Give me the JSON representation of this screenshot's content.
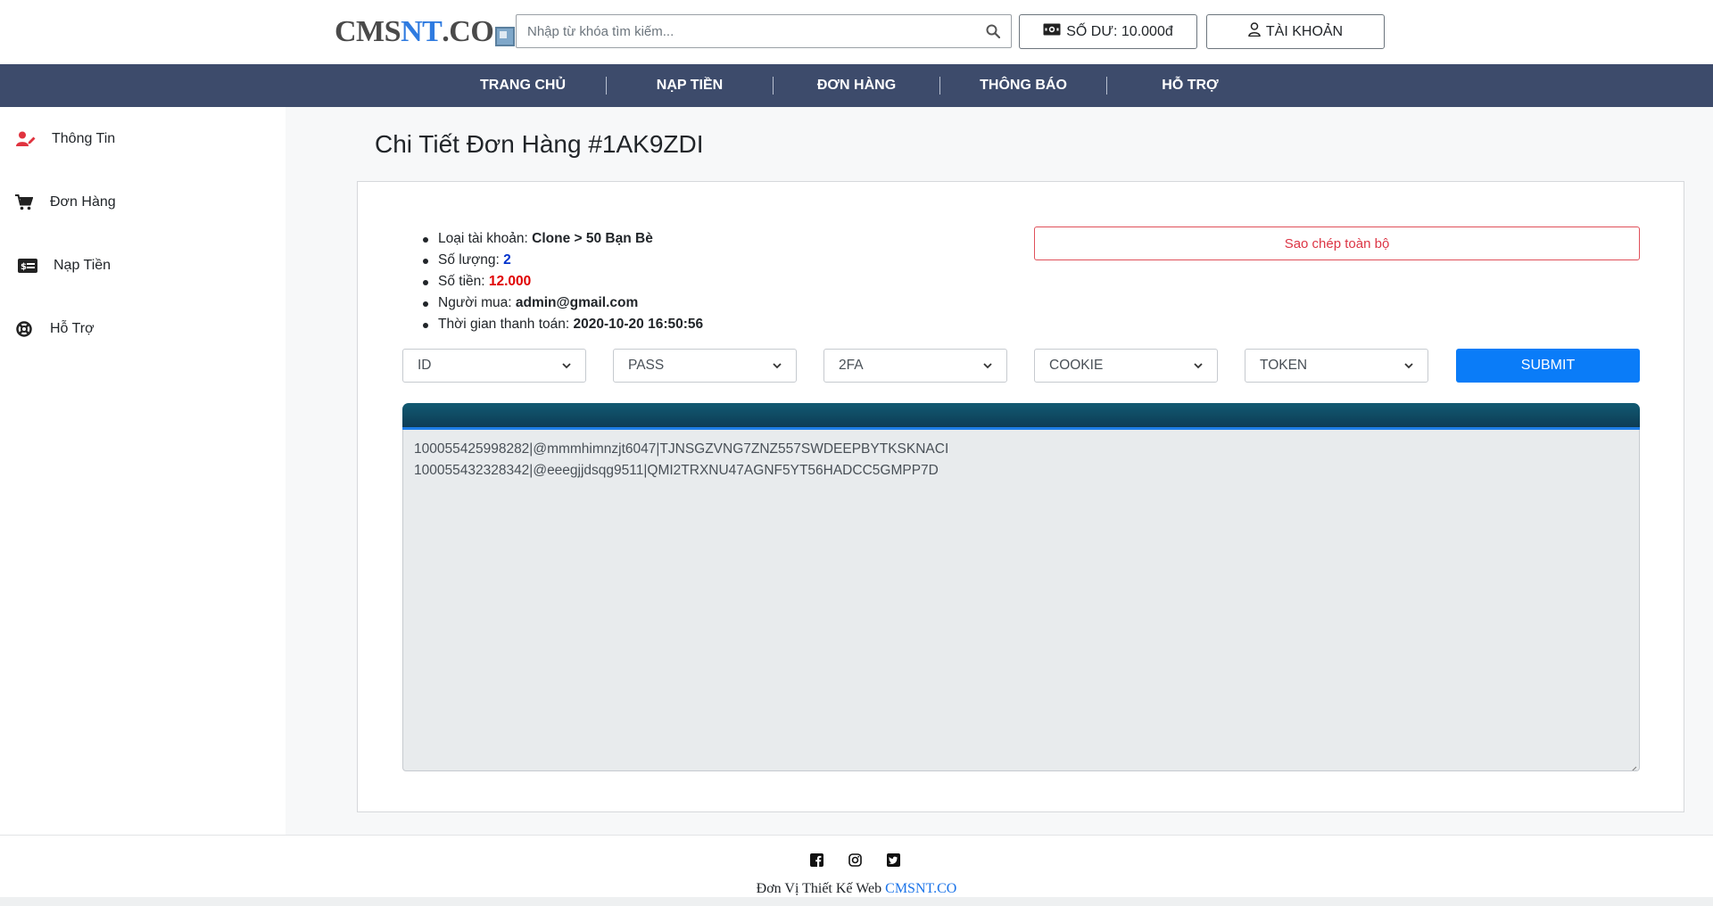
{
  "header": {
    "logo": {
      "part1": "CMS",
      "part2": "NT",
      "part3": ".CO"
    },
    "search": {
      "placeholder": "Nhập từ khóa tìm kiếm...",
      "value": ""
    },
    "balance_label": "SỐ DƯ: 10.000đ",
    "account_label": "TÀI KHOẢN"
  },
  "nav": {
    "items": [
      {
        "label": "TRANG CHỦ"
      },
      {
        "label": "NẠP TIỀN"
      },
      {
        "label": "ĐƠN HÀNG"
      },
      {
        "label": "THÔNG BÁO"
      },
      {
        "label": "HỖ TRỢ"
      }
    ]
  },
  "sidebar": {
    "items": [
      {
        "label": "Thông Tin",
        "icon": "user-edit-icon"
      },
      {
        "label": "Đơn Hàng",
        "icon": "cart-icon"
      },
      {
        "label": "Nạp Tiền",
        "icon": "money-card-icon"
      },
      {
        "label": "Hỗ Trợ",
        "icon": "lifebuoy-icon"
      }
    ]
  },
  "order": {
    "title": "Chi Tiết Đơn Hàng #1AK9ZDI",
    "info": [
      {
        "label": "Loại tài khoản: ",
        "value": "Clone > 50 Bạn Bè"
      },
      {
        "label": "Số lượng: ",
        "value": "2"
      },
      {
        "label": "Số tiền: ",
        "value": "12.000"
      },
      {
        "label": "Người mua: ",
        "value": "admin@gmail.com"
      },
      {
        "label": "Thời gian thanh toán: ",
        "value": "2020-10-20 16:50:56"
      }
    ],
    "copy_button": "Sao chép toàn bộ",
    "selects": [
      "ID",
      "PASS",
      "2FA",
      "COOKIE",
      "TOKEN"
    ],
    "submit_button": "SUBMIT",
    "output_lines": [
      "100055425998282|@mmmhimnzjt6047|TJNSGZVNG7ZNZ557SWDEEPBYTKSKNACI",
      "100055432328342|@eeegjjdsqg9511|QMI2TRXNU47AGNF5YT56HADCC5GMPP7D"
    ]
  },
  "footer": {
    "text": "Đơn Vị Thiết Kế Web ",
    "link": "CMSNT.CO",
    "socials": [
      "facebook-icon",
      "instagram-icon",
      "twitter-icon"
    ]
  },
  "colors": {
    "nav_bg": "#3d4b6b",
    "primary": "#0a7cf8",
    "danger": "#dc3545",
    "output_header": "#0d3c55"
  }
}
